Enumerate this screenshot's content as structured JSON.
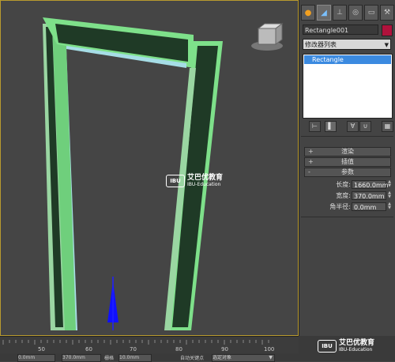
{
  "command_panel": {
    "tabs": [
      "create-icon",
      "modify-icon",
      "hierarchy-icon",
      "motion-icon",
      "display-icon",
      "utilities-icon"
    ],
    "object_name": "Rectangle001",
    "object_color": "#b0123c",
    "modifier_list_label": "修改器列表",
    "stack_items": [
      "Rectangle"
    ],
    "rollouts": {
      "render_label": "渲染",
      "interp_label": "插值",
      "params_label": "参数"
    },
    "params": {
      "length_label": "长度:",
      "length_value": "1660.0mm",
      "width_label": "宽度:",
      "width_value": "370.0mm",
      "corner_label": "角半径:",
      "corner_value": "0.0mm"
    }
  },
  "timeline": {
    "ticks": [
      "50",
      "60",
      "70",
      "80",
      "90",
      "100"
    ]
  },
  "status_bar": {
    "x_value": "0.0mm",
    "y_value": "370.0mm",
    "grid_label": "栅格",
    "grid_value": "10.0mm",
    "auto_key_label": "自动关键点",
    "selected_label": "选定对象"
  },
  "watermark": {
    "logo_text": "IBU",
    "cn_text": "艾巴优教育",
    "en_text": "IBU-Education"
  },
  "colors": {
    "frame_fill": "#1f3a26",
    "frame_edge": "#7ee08a",
    "selection_highlight": "#3b8ae0",
    "viewport_border": "#b89a2e"
  }
}
